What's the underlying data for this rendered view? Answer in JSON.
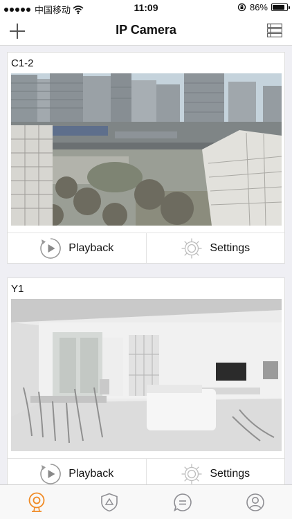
{
  "status_bar": {
    "carrier": "中国移动",
    "time": "11:09",
    "battery": "86%",
    "battery_level": 0.86
  },
  "nav": {
    "title": "IP Camera",
    "left_icon": "plus-icon",
    "right_icon": "list-icon"
  },
  "cameras": [
    {
      "name": "C1-2",
      "scene": "city-view",
      "playback_label": "Playback",
      "settings_label": "Settings"
    },
    {
      "name": "Y1",
      "scene": "living-room",
      "playback_label": "Playback",
      "settings_label": "Settings"
    }
  ],
  "tab_bar": {
    "active_index": 0,
    "active_color": "#f08a24",
    "inactive_color": "#8e8e93",
    "tabs": [
      {
        "icon": "camera-icon"
      },
      {
        "icon": "alert-shield-icon"
      },
      {
        "icon": "message-icon"
      },
      {
        "icon": "profile-icon"
      }
    ]
  }
}
